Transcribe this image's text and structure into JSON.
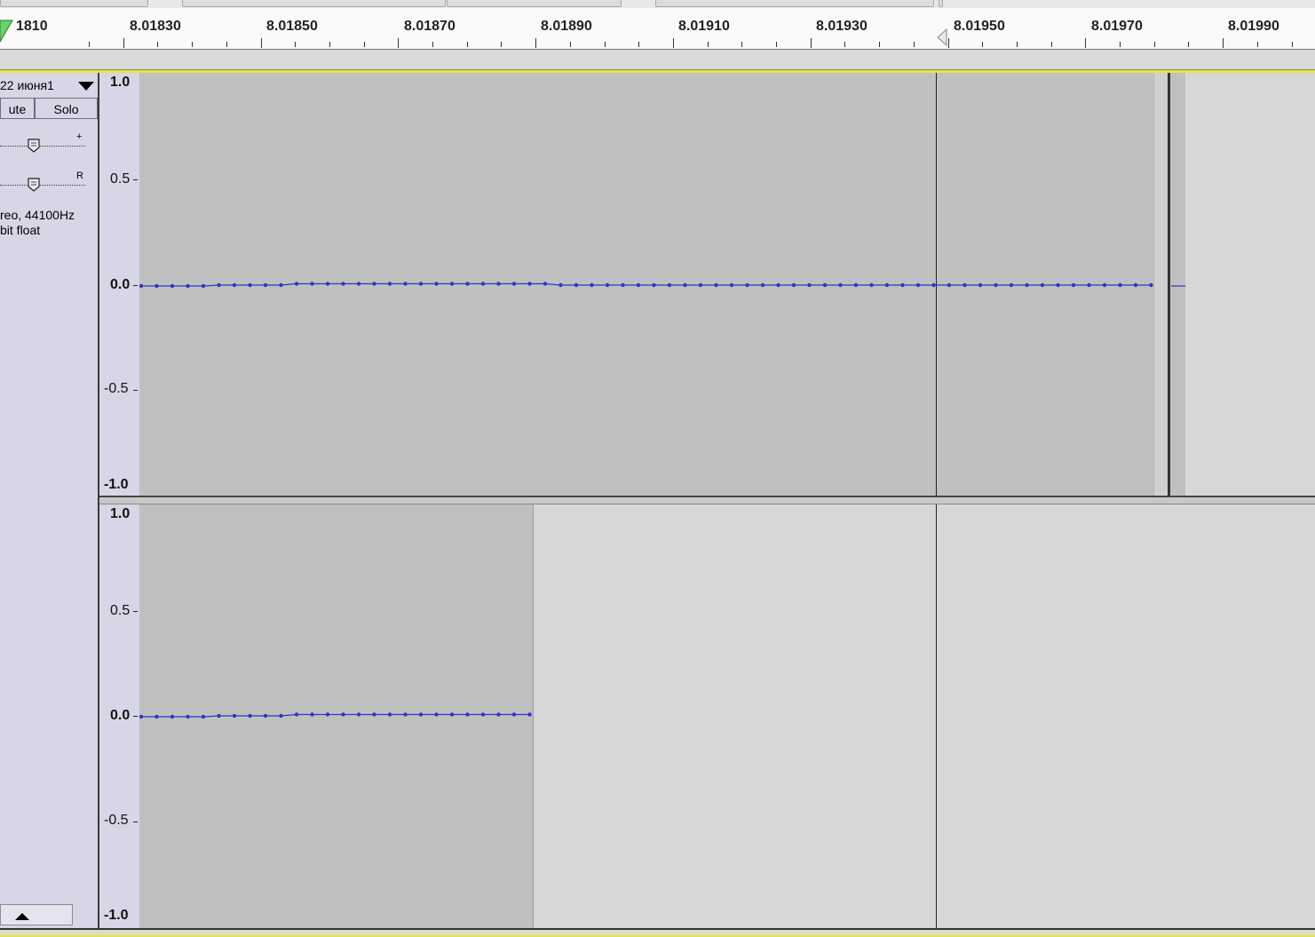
{
  "ruler": {
    "first_label": "1810",
    "labels": [
      "8.01830",
      "8.01850",
      "8.01870",
      "8.01890",
      "8.01910",
      "8.01930",
      "8.01950",
      "8.01970",
      "8.01990"
    ]
  },
  "track": {
    "name": "22 июня1",
    "mute_label": "ute",
    "solo_label": "Solo",
    "gain_end_label": "+",
    "pan_end_label": "R",
    "info_line1": "reo, 44100Hz",
    "info_line2": "bit float"
  },
  "scale": {
    "top": "1.0",
    "half": "0.5",
    "zero": "0.0",
    "neg_half": "-0.5",
    "bottom": "-1.0"
  },
  "colors": {
    "waveform": "#3232c8",
    "sample_dot": "#3232c8",
    "clip_background": "#c0c0c0",
    "empty_background": "#d7d7d7",
    "panel_background": "#d6d6e6",
    "selection_border": "#e6e24a"
  },
  "icons": {
    "track_menu": "triangle-down-icon",
    "collapse": "triangle-up-icon",
    "slider_thumb": "slider-thumb-icon",
    "play_region_marker": "green-triangle-icon"
  }
}
